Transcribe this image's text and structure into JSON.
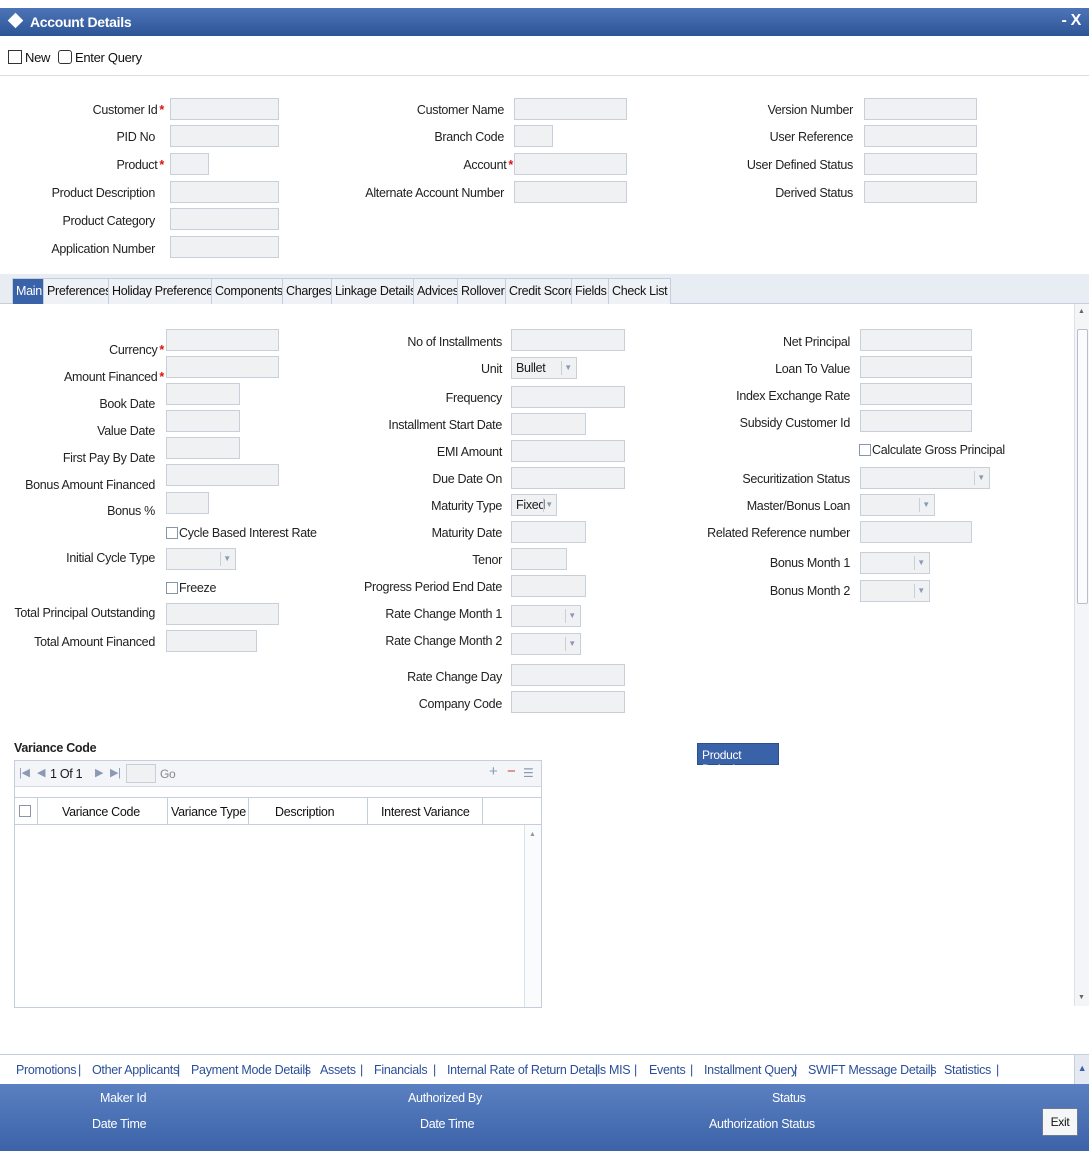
{
  "window": {
    "title": "Account Details",
    "controls": "- X"
  },
  "toolbar": {
    "new_label": "New",
    "enter_query_label": "Enter Query"
  },
  "header": {
    "customer_id": "Customer Id",
    "pid_no": "PID No",
    "product": "Product",
    "product_description": "Product Description",
    "product_category": "Product Category",
    "application_number": "Application Number",
    "customer_name": "Customer Name",
    "branch_code": "Branch Code",
    "account": "Account",
    "alternate_account_number": "Alternate Account Number",
    "version_number": "Version Number",
    "user_reference": "User Reference",
    "user_defined_status": "User Defined Status",
    "derived_status": "Derived Status",
    "required_mark": "*"
  },
  "tabs": [
    {
      "label": "Main"
    },
    {
      "label": "Preferences"
    },
    {
      "label": "Holiday Preferences"
    },
    {
      "label": "Components"
    },
    {
      "label": "Charges"
    },
    {
      "label": "Linkage Details"
    },
    {
      "label": "Advices"
    },
    {
      "label": "Rollover"
    },
    {
      "label": "Credit Score"
    },
    {
      "label": "Fields"
    },
    {
      "label": "Check List"
    }
  ],
  "main": {
    "col1": {
      "currency": "Currency",
      "amount_financed": "Amount Financed",
      "book_date": "Book Date",
      "value_date": "Value Date",
      "first_pay_by_date": "First Pay By Date",
      "bonus_amount_financed": "Bonus Amount Financed",
      "bonus_pct": "Bonus %",
      "cycle_based_interest_rate": "Cycle Based Interest Rate",
      "initial_cycle_type": "Initial Cycle Type",
      "freeze": "Freeze",
      "total_principal_outstanding": "Total Principal Outstanding",
      "total_amount_financed": "Total Amount Financed"
    },
    "col2": {
      "no_of_installments": "No of Installments",
      "unit": "Unit",
      "unit_value": "Bullet",
      "frequency": "Frequency",
      "installment_start_date": "Installment Start Date",
      "emi_amount": "EMI Amount",
      "due_date_on": "Due Date On",
      "maturity_type": "Maturity Type",
      "maturity_type_value": "Fixed",
      "maturity_date": "Maturity Date",
      "tenor": "Tenor",
      "progress_period_end_date": "Progress Period End Date",
      "rate_change_month_1": "Rate Change Month 1",
      "rate_change_month_2": "Rate Change Month 2",
      "rate_change_day": "Rate Change Day",
      "company_code": "Company Code"
    },
    "col3": {
      "net_principal": "Net Principal",
      "loan_to_value": "Loan To Value",
      "index_exchange_rate": "Index Exchange Rate",
      "subsidy_customer_id": "Subsidy Customer Id",
      "calculate_gross_principal": "Calculate Gross Principal",
      "securitization_status": "Securitization Status",
      "master_bonus_loan": "Master/Bonus Loan",
      "related_reference_number": "Related Reference number",
      "bonus_month_1": "Bonus Month 1",
      "bonus_month_2": "Bonus Month 2"
    }
  },
  "variance": {
    "section_title": "Variance Code",
    "pager_text": "1 Of 1",
    "go_label": "Go",
    "columns": [
      "Variance Code",
      "Variance Type",
      "Description",
      "Interest Variance"
    ],
    "product_default_label": "Product Default"
  },
  "links": [
    "Promotions",
    "Other Applicants",
    "Payment Mode Details",
    "Assets",
    "Financials",
    "Internal Rate of Return Details",
    "MIS",
    "Events",
    "Installment Query",
    "SWIFT Message Details",
    "Statistics"
  ],
  "footer": {
    "maker_id": "Maker Id",
    "date_time_1": "Date Time",
    "authorized_by": "Authorized By",
    "date_time_2": "Date Time",
    "status": "Status",
    "authorization_status": "Authorization Status",
    "exit_label": "Exit"
  }
}
